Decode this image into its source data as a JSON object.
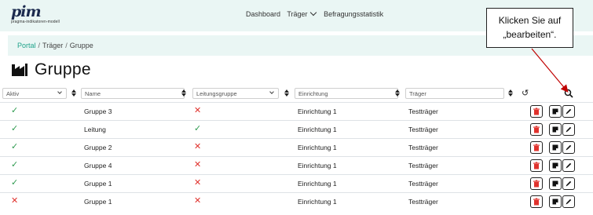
{
  "logo": {
    "mark": "pim",
    "subtitle": "pragma-indikatoren-modell"
  },
  "nav": {
    "dashboard": "Dashboard",
    "traeger": "Träger",
    "befragungsstatistik": "Befragungsstatistik"
  },
  "breadcrumb": {
    "portal": "Portal",
    "sep1": "/",
    "traeger": "Träger",
    "sep2": "/",
    "current": "Gruppe"
  },
  "page": {
    "title": "Gruppe",
    "title_icon": "factory-icon"
  },
  "filters": {
    "aktiv": "Aktiv",
    "name": "Name",
    "leitungsgruppe": "Leitungsgruppe",
    "einrichtung": "Einrichtung",
    "traeger": "Träger"
  },
  "table": {
    "rows": [
      {
        "aktiv": "✓",
        "name": "Gruppe 3",
        "leitung": "✕",
        "einrichtung": "Einrichtung 1",
        "traeger": "Testträger"
      },
      {
        "aktiv": "✓",
        "name": "Leitung",
        "leitung": "✓",
        "einrichtung": "Einrichtung 1",
        "traeger": "Testträger"
      },
      {
        "aktiv": "✓",
        "name": "Gruppe 2",
        "leitung": "✕",
        "einrichtung": "Einrichtung 1",
        "traeger": "Testträger"
      },
      {
        "aktiv": "✓",
        "name": "Gruppe 4",
        "leitung": "✕",
        "einrichtung": "Einrichtung 1",
        "traeger": "Testträger"
      },
      {
        "aktiv": "✓",
        "name": "Gruppe 1",
        "leitung": "✕",
        "einrichtung": "Einrichtung 1",
        "traeger": "Testträger"
      },
      {
        "aktiv": "✕",
        "name": "Gruppe 1",
        "leitung": "✕",
        "einrichtung": "Einrichtung 1",
        "traeger": "Testträger"
      }
    ],
    "actions": [
      "trash-icon",
      "copy-icon",
      "pencil-icon"
    ]
  },
  "callout": {
    "line1": "Klicken Sie auf",
    "line2": "„bearbeiten“."
  },
  "colors": {
    "nav_bg": "#eaf6f4",
    "link": "#1ea28a",
    "check": "#2e9a4f",
    "cross": "#e0322d",
    "delete": "#e0322d",
    "logo": "#1b2a4e"
  }
}
